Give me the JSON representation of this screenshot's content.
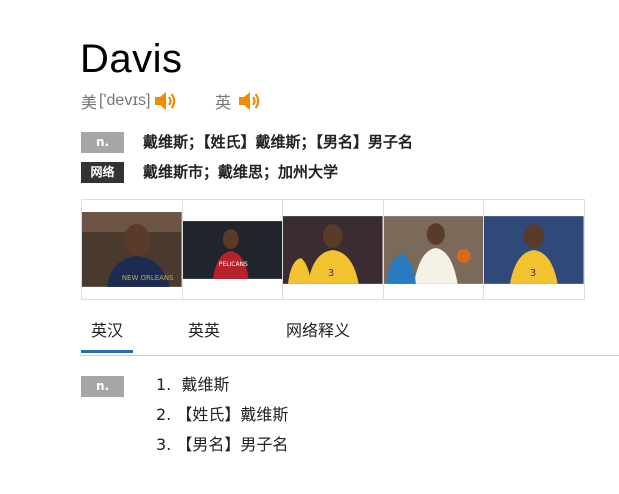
{
  "headword": "Davis",
  "pronunciations": {
    "us": {
      "label": "美",
      "phonetic": "['devɪs]"
    },
    "uk": {
      "label": "英"
    }
  },
  "summary": [
    {
      "badge": "n.",
      "badge_color": "#a6a6a6",
      "text": "戴维斯；【姓氏】戴维斯；【男名】男子名"
    },
    {
      "badge": "网络",
      "badge_color": "#333333",
      "text": "戴维斯市；戴维思；加州大学"
    }
  ],
  "tabs": [
    {
      "label": "英汉",
      "active": true
    },
    {
      "label": "英英",
      "active": false
    },
    {
      "label": "网络释义",
      "active": false
    }
  ],
  "detail": {
    "pos": "n.",
    "senses": [
      {
        "num": "1.",
        "text": "戴维斯"
      },
      {
        "num": "2.",
        "text": "【姓氏】戴维斯"
      },
      {
        "num": "3.",
        "text": "【男名】男子名"
      }
    ]
  },
  "colors": {
    "accent_tab": "#1e6fc0",
    "speaker": "#f08c00"
  },
  "icons": {
    "speaker": "speaker-icon"
  }
}
